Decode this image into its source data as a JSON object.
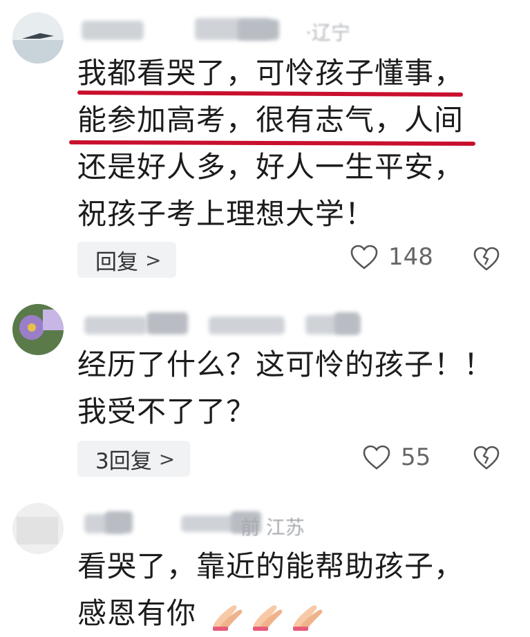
{
  "comments": [
    {
      "meta_visible": "·辽宁",
      "lines": [
        "我都看哭了，可怜孩子懂事，",
        "能参加高考，很有志气，人间",
        "还是好人多，好人一生平安，",
        "祝孩子考上理想大学！"
      ],
      "reply_label": "回复",
      "like_count": "148"
    },
    {
      "meta_visible": "",
      "lines": [
        "经历了什么？这可怜的孩子！！",
        "我受不了了？"
      ],
      "reply_label": "3回复",
      "like_count": "55"
    },
    {
      "meta_visible": "前 江苏",
      "lines": [
        "看哭了，靠近的能帮助孩子，",
        "感恩有你"
      ]
    }
  ],
  "icons": {
    "like": "heart-outline-icon",
    "dislike": "broken-heart-icon",
    "reply_chevron": "chevron-right-icon",
    "emoji": "folded-hands-emoji"
  },
  "colors": {
    "underline": "#c8102e",
    "text": "#1c1c1c",
    "muted": "#666666",
    "reply_bg": "#f1f2f4"
  }
}
